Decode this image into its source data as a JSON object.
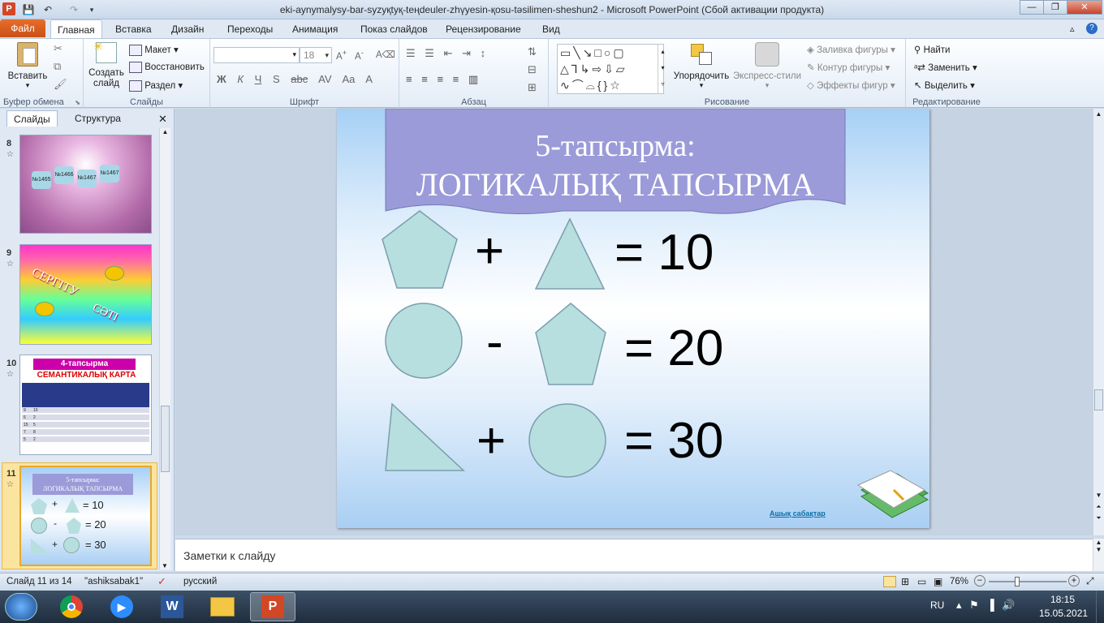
{
  "titlebar": {
    "title": "eki-aynymalysy-bar-syzyқtyқ-teңdeuler-zhүyesin-қosu-tәsilimen-sheshun2  -  Microsoft PowerPoint (Сбой активации продукта)"
  },
  "tabs": [
    "Файл",
    "Главная",
    "Вставка",
    "Дизайн",
    "Переходы",
    "Анимация",
    "Показ слайдов",
    "Рецензирование",
    "Вид"
  ],
  "ribbon": {
    "clipboard": {
      "label": "Буфер обмена",
      "paste": "Вставить"
    },
    "slides": {
      "label": "Слайды",
      "new_slide": "Создать слайд",
      "layout": "Макет",
      "reset": "Восстановить",
      "section": "Раздел"
    },
    "font": {
      "label": "Шрифт",
      "size": "18"
    },
    "paragraph": {
      "label": "Абзац"
    },
    "drawing": {
      "label": "Рисование",
      "arrange": "Упорядочить",
      "quick_styles": "Экспресс-стили",
      "fill": "Заливка фигуры",
      "outline": "Контур фигуры",
      "effects": "Эффекты фигур"
    },
    "editing": {
      "label": "Редактирование",
      "find": "Найти",
      "replace": "Заменить",
      "select": "Выделить"
    }
  },
  "panel": {
    "tabs": [
      "Слайды",
      "Структура"
    ],
    "slides": [
      {
        "num": "8",
        "labels": [
          "№1465",
          "№1466",
          "№1467",
          "№1467"
        ],
        "tags": [
          "1",
          "2",
          "3",
          "4"
        ]
      },
      {
        "num": "9",
        "labels": [
          "СЕРГІТУ",
          "СӘТІ"
        ]
      },
      {
        "num": "10",
        "title": "4-тапсырма",
        "subtitle": "СЕМАНТИКАЛЫҚ КАРТА",
        "rows": [
          "9",
          "6",
          "15",
          "7",
          "5"
        ],
        "rows2": [
          "10",
          "2",
          "5",
          "8",
          "2"
        ]
      },
      {
        "num": "11",
        "title1": "5-тапсырма:",
        "title2": "ЛОГИКАЛЫҚ ТАПСЫРМА",
        "eq1": "= 10",
        "eq2": "= 20",
        "eq3": "= 30"
      }
    ]
  },
  "slide": {
    "title_line1": "5-тапсырма:",
    "title_line2": "ЛОГИКАЛЫҚ ТАПСЫРМА",
    "row1": {
      "op": "+",
      "result": "= 10"
    },
    "row2": {
      "op": "-",
      "result": "= 20"
    },
    "row3": {
      "op": "+",
      "result": "= 30"
    },
    "footer_link": "Ашық сабақтар"
  },
  "notes": {
    "placeholder": "Заметки к слайду"
  },
  "status": {
    "slide_pos": "Слайд 11 из 14",
    "theme": "\"ashiksabak1\"",
    "language": "русский",
    "zoom": "76%"
  },
  "taskbar": {
    "lang": "RU",
    "time": "18:15",
    "date": "15.05.2021"
  },
  "colors": {
    "shape_fill": "#b8dfdf",
    "banner": "#9b9bd9",
    "accent": "#2b579a"
  }
}
